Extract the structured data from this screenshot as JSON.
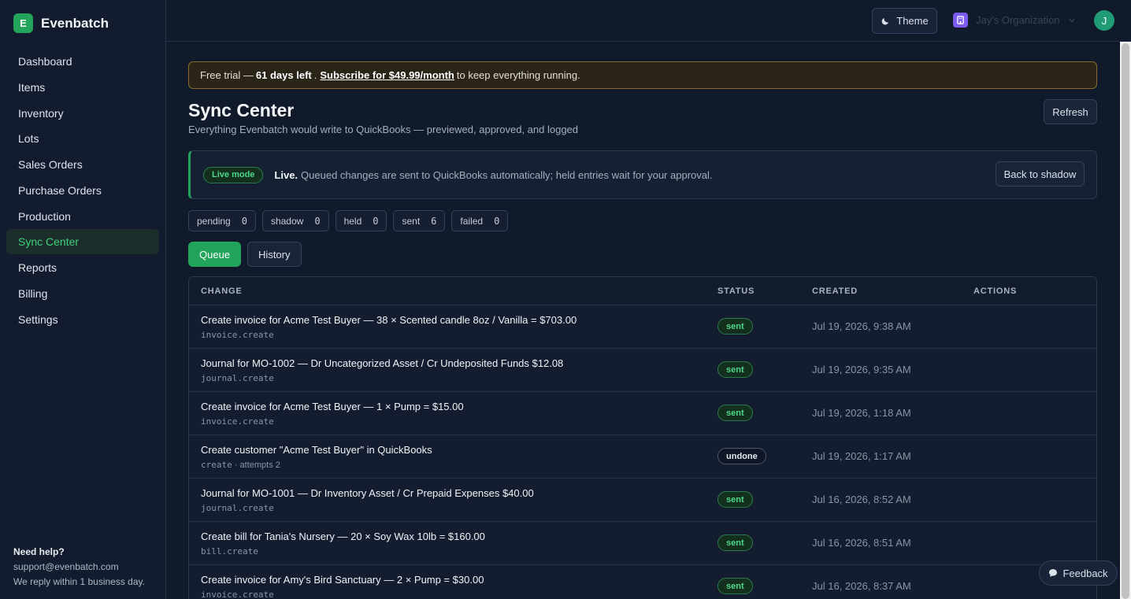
{
  "app": {
    "logo_letter": "E",
    "name": "Evenbatch"
  },
  "sidebar": {
    "items": [
      {
        "label": "Dashboard"
      },
      {
        "label": "Items"
      },
      {
        "label": "Inventory"
      },
      {
        "label": "Lots"
      },
      {
        "label": "Sales Orders"
      },
      {
        "label": "Purchase Orders"
      },
      {
        "label": "Production"
      },
      {
        "label": "Sync Center",
        "active": true
      },
      {
        "label": "Reports"
      },
      {
        "label": "Billing"
      },
      {
        "label": "Settings"
      }
    ],
    "help": {
      "heading": "Need help?",
      "email": "support@evenbatch.com",
      "note": "We reply within 1 business day."
    }
  },
  "topbar": {
    "theme_label": "Theme",
    "org_name": "Jay's Organization",
    "avatar_letter": "J"
  },
  "trial": {
    "prefix": "Free trial —",
    "days": "61 days left",
    "dot": ".",
    "link": "Subscribe for $49.99/month",
    "suffix": "to keep everything running."
  },
  "page": {
    "title": "Sync Center",
    "subtitle": "Everything Evenbatch would write to QuickBooks — previewed, approved, and logged",
    "refresh_label": "Refresh"
  },
  "mode": {
    "badge": "Live mode",
    "strong": "Live.",
    "text": "Queued changes are sent to QuickBooks automatically; held entries wait for your approval.",
    "back_label": "Back to shadow"
  },
  "counters": [
    {
      "label": "pending",
      "value": "0"
    },
    {
      "label": "shadow",
      "value": "0"
    },
    {
      "label": "held",
      "value": "0"
    },
    {
      "label": "sent",
      "value": "6"
    },
    {
      "label": "failed",
      "value": "0"
    }
  ],
  "tabs": [
    {
      "label": "Queue",
      "active": true
    },
    {
      "label": "History"
    }
  ],
  "table": {
    "headers": {
      "change": "CHANGE",
      "status": "STATUS",
      "created": "CREATED",
      "actions": "ACTIONS"
    },
    "rows": [
      {
        "change": "Create invoice for Acme Test Buyer — 38 × Scented candle 8oz / Vanilla = $703.00",
        "op": "invoice.create",
        "extra": "",
        "status": "sent",
        "created": "Jul 19, 2026, 9:38 AM"
      },
      {
        "change": "Journal for MO-1002 — Dr Uncategorized Asset / Cr Undeposited Funds $12.08",
        "op": "journal.create",
        "extra": "",
        "status": "sent",
        "created": "Jul 19, 2026, 9:35 AM"
      },
      {
        "change": "Create invoice for Acme Test Buyer — 1 × Pump = $15.00",
        "op": "invoice.create",
        "extra": "",
        "status": "sent",
        "created": "Jul 19, 2026, 1:18 AM"
      },
      {
        "change": "Create customer \"Acme Test Buyer\" in QuickBooks",
        "op": "create",
        "extra": " · attempts 2",
        "status": "undone",
        "created": "Jul 19, 2026, 1:17 AM"
      },
      {
        "change": "Journal for MO-1001 — Dr Inventory Asset / Cr Prepaid Expenses $40.00",
        "op": "journal.create",
        "extra": "",
        "status": "sent",
        "created": "Jul 16, 2026, 8:52 AM"
      },
      {
        "change": "Create bill for Tania's Nursery — 20 × Soy Wax 10lb = $160.00",
        "op": "bill.create",
        "extra": "",
        "status": "sent",
        "created": "Jul 16, 2026, 8:51 AM"
      },
      {
        "change": "Create invoice for Amy's Bird Sanctuary — 2 × Pump = $30.00",
        "op": "invoice.create",
        "extra": "",
        "status": "sent",
        "created": "Jul 16, 2026, 8:37 AM"
      }
    ]
  },
  "feedback": {
    "label": "Feedback"
  },
  "colors": {
    "accent": "#22a55a",
    "background": "#111a2b",
    "warning_border": "#8a6a2c"
  }
}
